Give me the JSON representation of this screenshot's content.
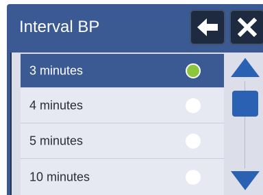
{
  "dialog": {
    "title": "Interval BP",
    "back_icon": "arrow-left-icon",
    "close_icon": "close-icon"
  },
  "options": [
    {
      "label": "3 minutes",
      "selected": true
    },
    {
      "label": "4 minutes",
      "selected": false
    },
    {
      "label": "5 minutes",
      "selected": false
    },
    {
      "label": "10 minutes",
      "selected": false
    }
  ],
  "scrollbar": {
    "up_icon": "triangle-up-icon",
    "down_icon": "triangle-down-icon"
  },
  "colors": {
    "header": "#3b5a94",
    "selected_row": "#3b5a94",
    "radio_selected": "#8cc63f",
    "scroll_accent": "#2b61b2",
    "header_button": "#1d2a3f"
  }
}
